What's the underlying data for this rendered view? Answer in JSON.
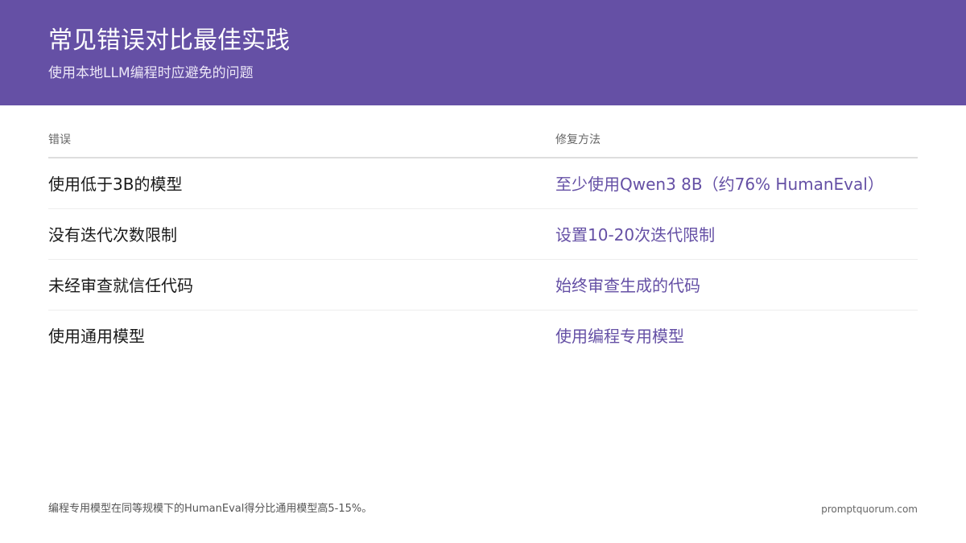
{
  "header": {
    "title": "常见错误对比最佳实践",
    "subtitle": "使用本地LLM编程时应避免的问题"
  },
  "table": {
    "columns": [
      "错误",
      "修复方法"
    ],
    "rows": [
      {
        "mistake": "使用低于3B的模型",
        "fix": "至少使用Qwen3 8B（约76% HumanEval）"
      },
      {
        "mistake": "没有迭代次数限制",
        "fix": "设置10-20次迭代限制"
      },
      {
        "mistake": "未经审查就信任代码",
        "fix": "始终审查生成的代码"
      },
      {
        "mistake": "使用通用模型",
        "fix": "使用编程专用模型"
      }
    ]
  },
  "footer": {
    "note": "编程专用模型在同等规模下的HumanEval得分比通用模型高5-15%。",
    "site": "promptquorum.com"
  },
  "colors": {
    "header_bg": "#6550a5",
    "accent": "#6550a5",
    "text": "#1a1a1a"
  }
}
